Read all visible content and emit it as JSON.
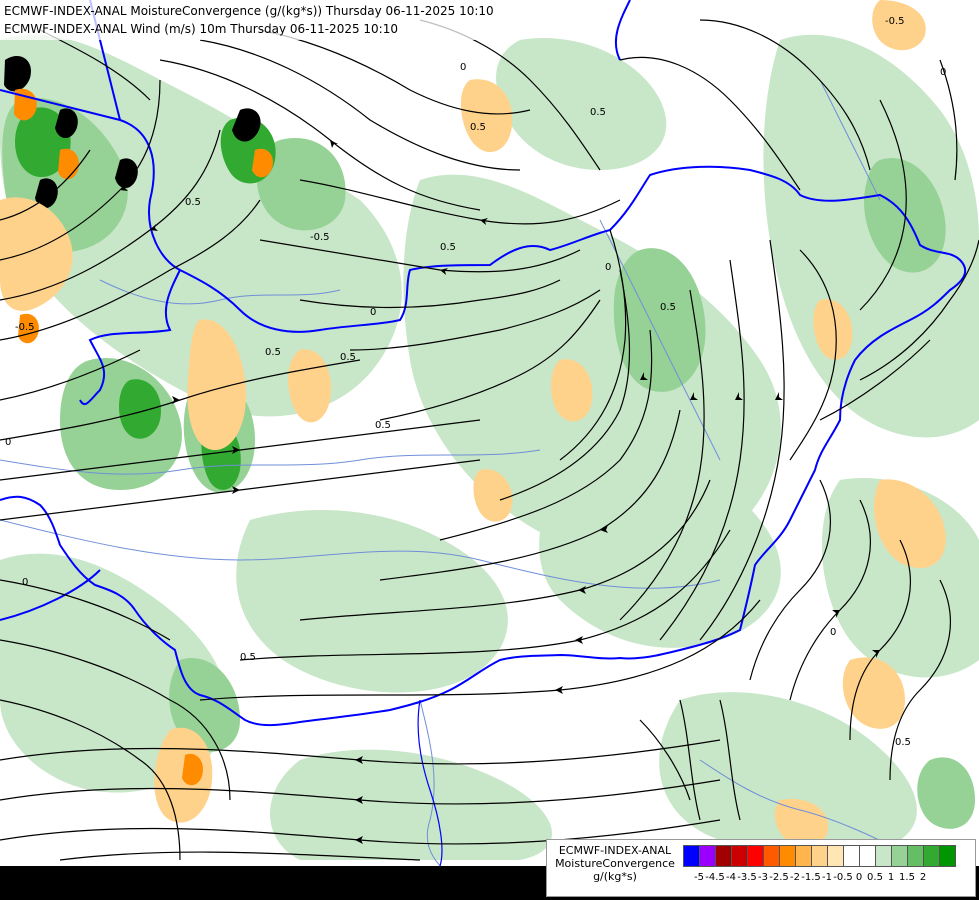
{
  "header": {
    "line1": "ECMWF-INDEX-ANAL MoistureConvergence (g/(kg*s)) Thursday 06-11-2025 10:10",
    "line2": "ECMWF-INDEX-ANAL Wind (m/s) 10m Thursday 06-11-2025 10:10"
  },
  "legend": {
    "title_line1": "ECMWF-INDEX-ANAL",
    "title_line2": "MoistureConvergence",
    "unit": "g/(kg*s)",
    "colors": [
      "#0000ff",
      "#9b00ff",
      "#a00000",
      "#cc0000",
      "#ff0000",
      "#ff5a00",
      "#ff8c00",
      "#ffb44c",
      "#ffd28c",
      "#ffe6b4",
      "#ffffff",
      "#ffffff",
      "#c8e6c8",
      "#96d296",
      "#64be64",
      "#32aa32",
      "#009600"
    ],
    "ticks": [
      "-5",
      "-4.5",
      "-4",
      "-3.5",
      "-3",
      "-2.5",
      "-2",
      "-1.5",
      "-1",
      "-0.5",
      "0",
      "0.5",
      "1",
      "1.5",
      "2"
    ]
  },
  "contour_labels": [
    "0.5",
    "0",
    "-0.5"
  ],
  "colors": {
    "border": "#0000ff",
    "river": "#6f8fd8",
    "streamline": "#000000",
    "convergence_light": "#c8e6c8",
    "convergence_mid": "#96d296",
    "convergence_strong": "#32aa32",
    "divergence_light": "#ffe6b4",
    "divergence_mid": "#ffd28c",
    "divergence_strong": "#ff8c00"
  }
}
